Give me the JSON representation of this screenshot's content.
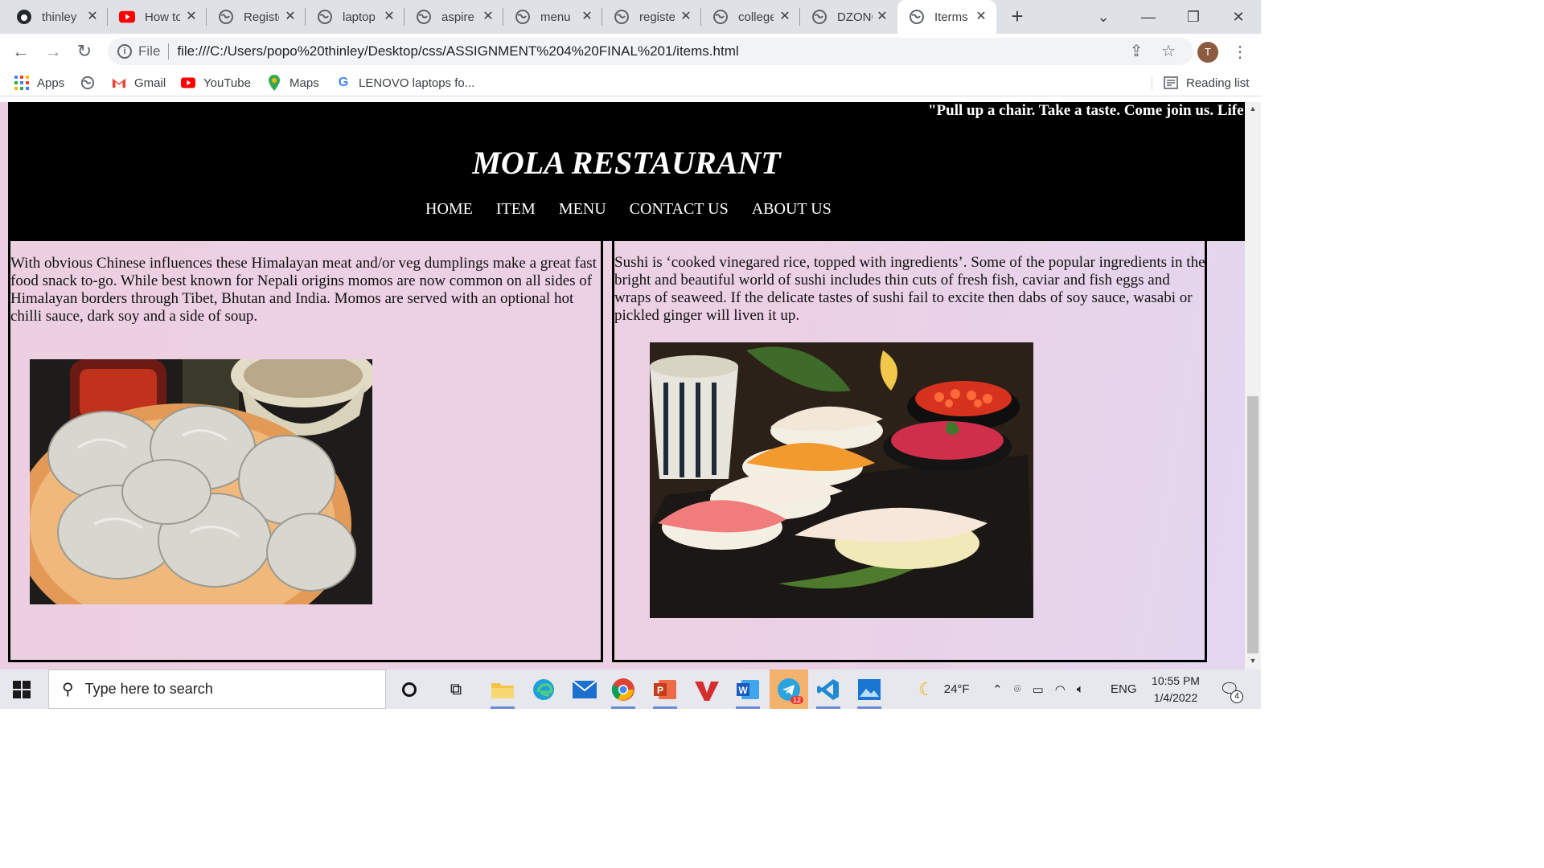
{
  "browser": {
    "tabs": [
      {
        "title": "thinley",
        "icon": "github-icon"
      },
      {
        "title": "How to",
        "icon": "youtube-icon"
      },
      {
        "title": "Registe",
        "icon": "globe-icon"
      },
      {
        "title": "laptop",
        "icon": "globe-icon"
      },
      {
        "title": "aspire",
        "icon": "globe-icon"
      },
      {
        "title": "menu",
        "icon": "globe-icon"
      },
      {
        "title": "registe",
        "icon": "globe-icon"
      },
      {
        "title": "college",
        "icon": "globe-icon"
      },
      {
        "title": "DZONG",
        "icon": "globe-icon"
      },
      {
        "title": "Iterms",
        "icon": "globe-icon",
        "active": true
      }
    ],
    "address": {
      "scheme_label": "File",
      "url": "file:///C:/Users/popo%20thinley/Desktop/css/ASSIGNMENT%204%20FINAL%201/items.html"
    },
    "profile_initial": "T",
    "bookmarks": {
      "apps": "Apps",
      "gmail": "Gmail",
      "youtube": "YouTube",
      "maps": "Maps",
      "lenovo": "LENOVO laptops fo...",
      "reading_list": "Reading list"
    }
  },
  "site": {
    "marquee": "\"Pull up a chair. Take a taste. Come join us. Life i",
    "title": "MOLA RESTAURANT",
    "nav": [
      "HOME",
      "ITEM",
      "MENU",
      "CONTACT US",
      "ABOUT US"
    ],
    "items": [
      {
        "text": "With obvious Chinese influences these Himalayan meat and/or veg dumplings make a great fast food snack to-go. While best known for Nepali origins momos are now common on all sides of Himalayan borders through Tibet, Bhutan and India. Momos are served with an optional hot chilli sauce, dark soy and a side of soup.",
        "image": "momos-photo"
      },
      {
        "text": "Sushi is ‘cooked vinegared rice, topped with ingredients’. Some of the popular ingredients in the bright and beautiful world of sushi includes thin cuts of fresh fish, caviar and fish eggs and wraps of seaweed. If the delicate tastes of sushi fail to excite then dabs of soy sauce, wasabi or pickled ginger will liven it up.",
        "image": "sushi-photo"
      }
    ]
  },
  "taskbar": {
    "search_placeholder": "Type here to search",
    "weather": "24°F",
    "language": "ENG",
    "time": "10:55 PM",
    "date": "1/4/2022",
    "notifications": "4",
    "telegram_badge": "12"
  },
  "colors": {
    "page_bg": "#ecd0e2",
    "header_bg": "#000000",
    "tabstrip_bg": "#dee1e6"
  }
}
